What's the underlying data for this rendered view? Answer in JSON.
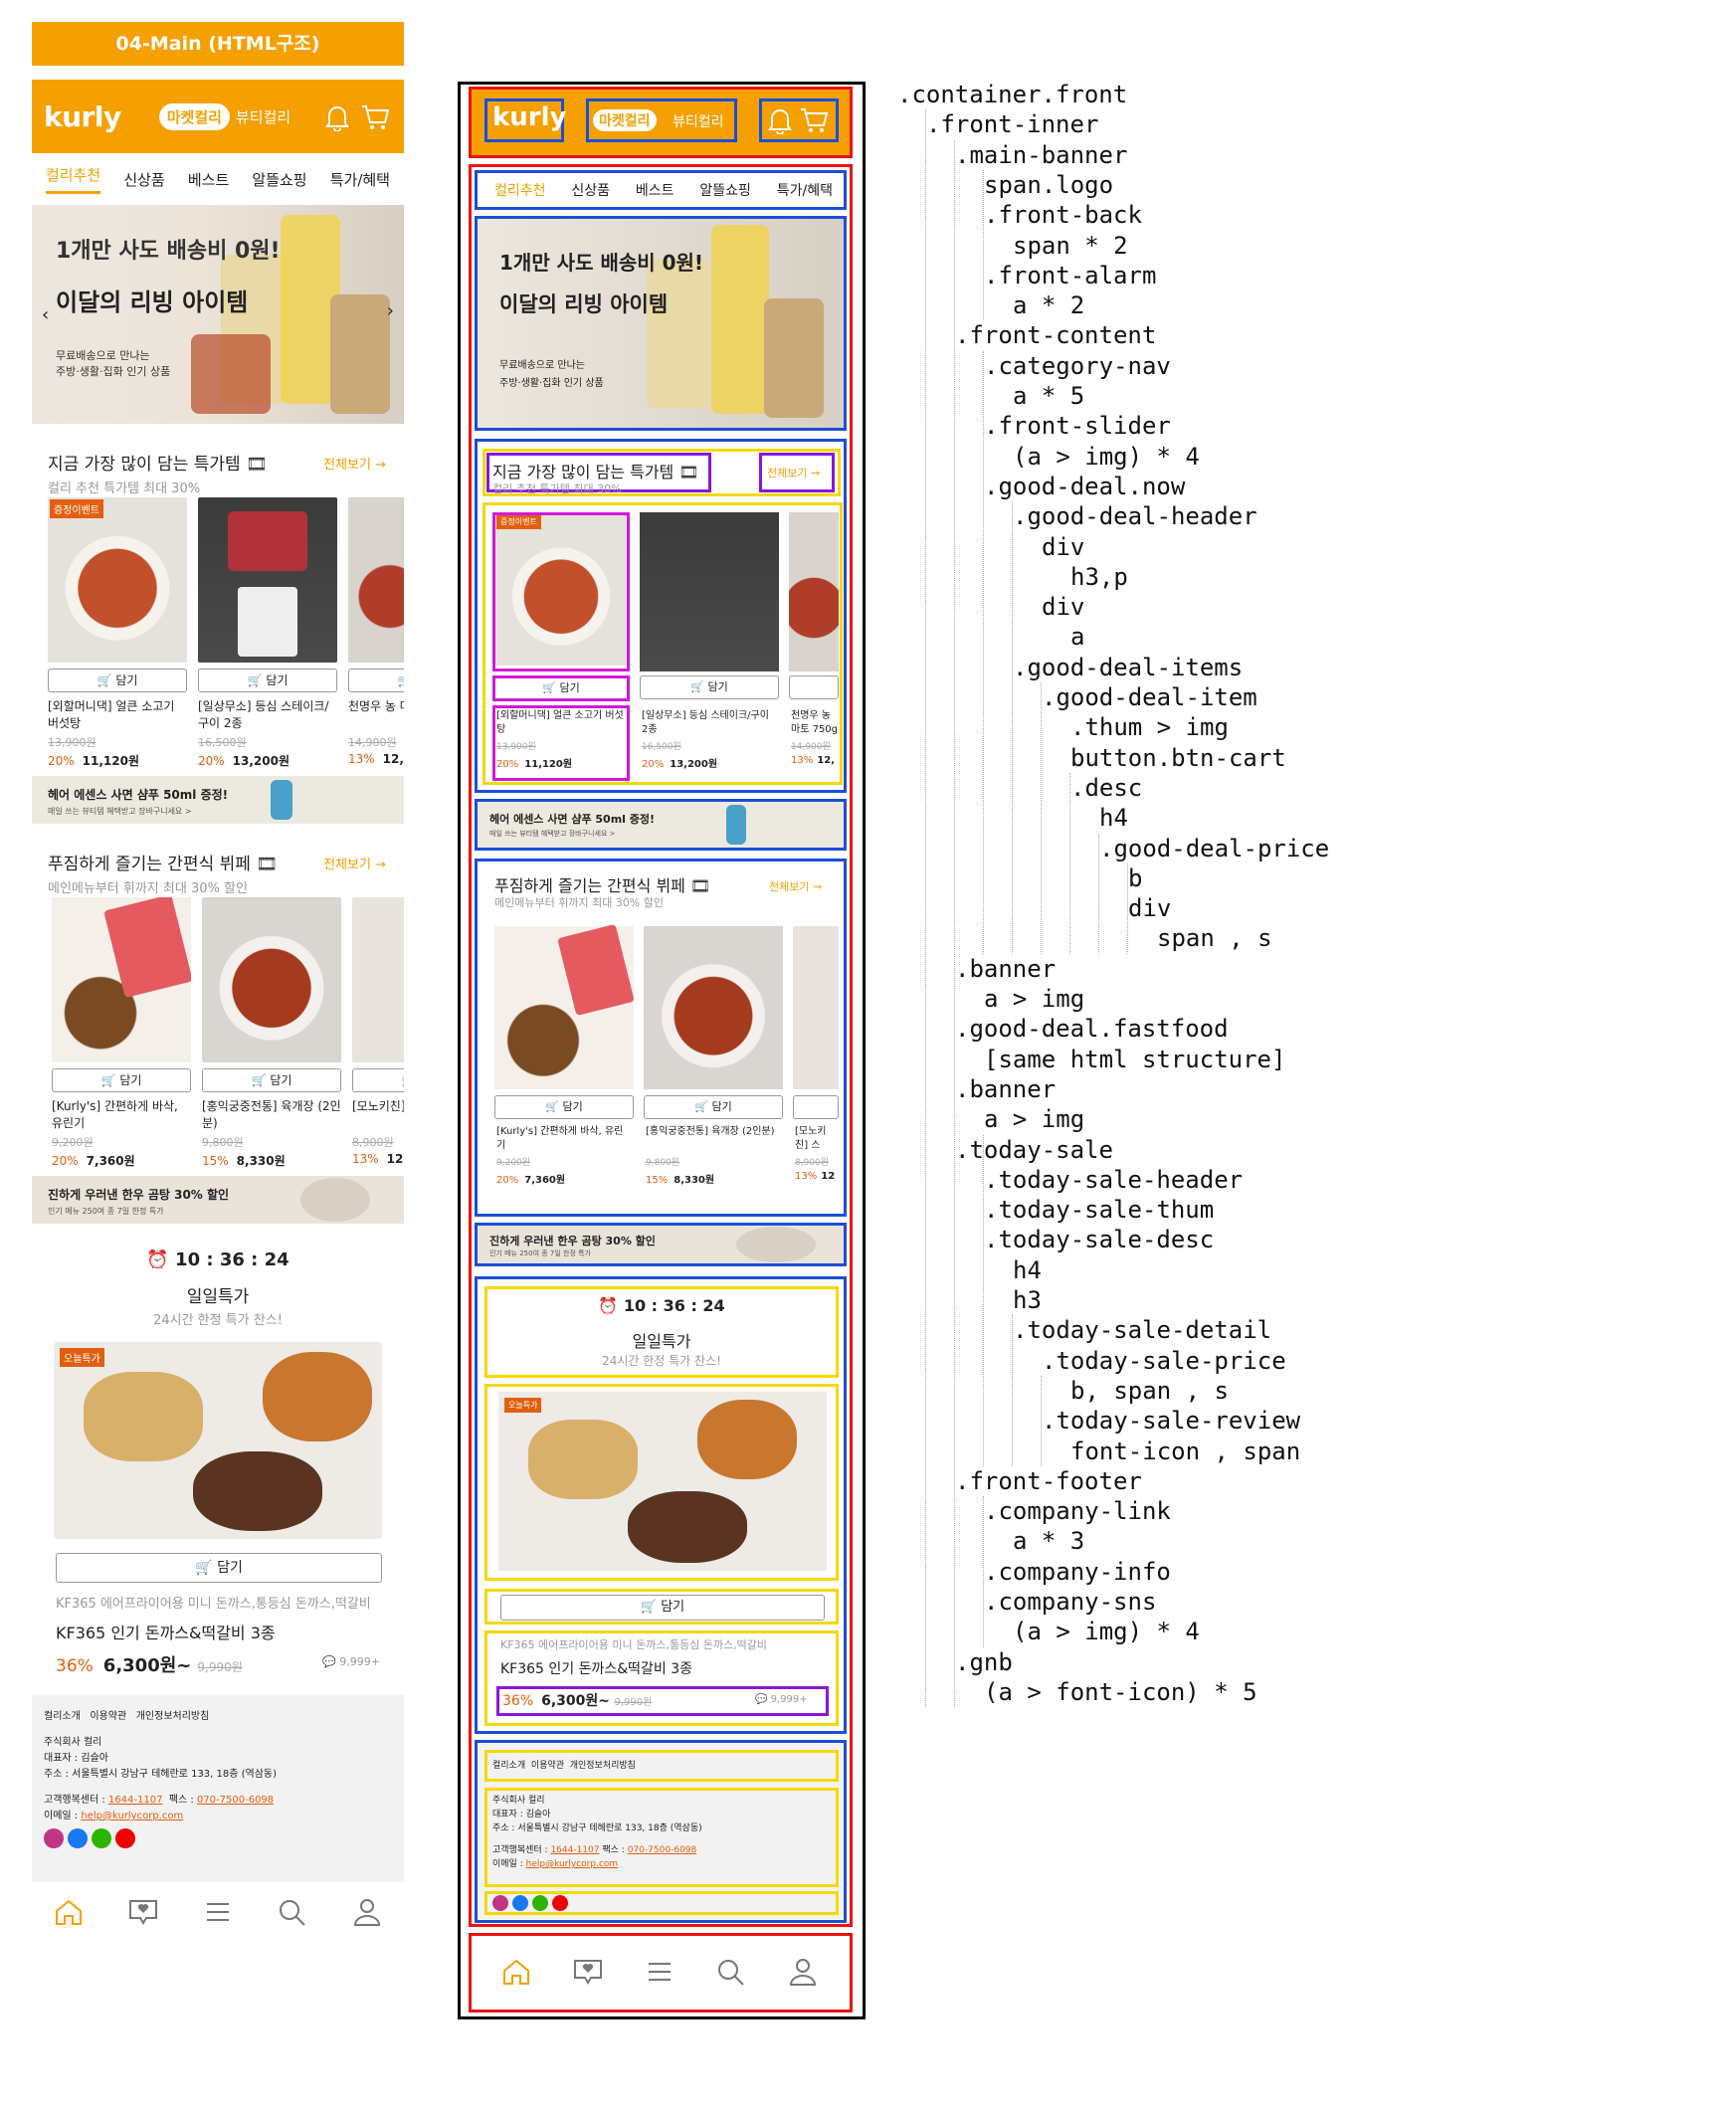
{
  "title": "04-Main (HTML구조)",
  "header": {
    "logo": "kurly",
    "market_tab": "마켓컬리",
    "beauty_tab": "뷰티컬리",
    "icons": [
      "bell-icon",
      "cart-icon"
    ]
  },
  "category_nav": [
    "컬리추천",
    "신상품",
    "베스트",
    "알뜰쇼핑",
    "특가/혜택"
  ],
  "hero": {
    "line1": "1개만 사도 배송비 0원!",
    "line2": "이달의 리빙 아이템",
    "line3": "무료배송으로 만나는",
    "line4": "주방·생활·집화 인기 상품"
  },
  "deal_now": {
    "title": "지금 가장 많이 담는 특가템 🎞",
    "subtitle": "컬리 추천 특가템 최대 30%",
    "more": "전체보기 →",
    "items": [
      {
        "badge": "증정이벤트",
        "cart": "담기",
        "name": "[외할머니댁] 얼큰 소고기 버섯탕",
        "orig": "13,900원",
        "pct": "20%",
        "price": "11,120원"
      },
      {
        "badge": "",
        "cart": "담기",
        "name": "[일상무소] 등심 스테이크/구이 2종",
        "orig": "16,500원",
        "pct": "20%",
        "price": "13,200원"
      },
      {
        "badge": "",
        "cart": "담기",
        "name": "천명우 농 마토 750g",
        "orig": "14,900원",
        "pct": "13%",
        "price": "12,"
      }
    ]
  },
  "banner1": {
    "title": "헤어 에센스 사면 샴푸 50ml 증정!",
    "sub": "매일 쓰는 뷰티템 혜택받고 장바구니세요 >"
  },
  "deal_fast": {
    "title": "푸짐하게 즐기는 간편식 뷔페 🎞",
    "subtitle": "메인메뉴부터 휘까지 최대 30% 할인",
    "more": "전체보기 →",
    "items": [
      {
        "cart": "담기",
        "name": "[Kurly's] 간편하게 바삭, 유린기",
        "orig": "9,200원",
        "pct": "20%",
        "price": "7,360원"
      },
      {
        "cart": "담기",
        "name": "[홍익궁중전통] 육개장 (2인분)",
        "orig": "9,800원",
        "pct": "15%",
        "price": "8,330원"
      },
      {
        "cart": "담기",
        "name": "[모노키친] 스",
        "orig": "8,900원",
        "pct": "13%",
        "price": "12"
      }
    ]
  },
  "banner2": {
    "title": "진하게 우러낸 한우 곰탕 30% 할인",
    "sub": "인기 메뉴 250여 종 7일 한정 특가"
  },
  "today_sale": {
    "timer": "10 : 36 : 24",
    "title": "일일특가",
    "subtitle": "24시간 한정 특가 찬스!",
    "badge": "오늘특가",
    "cart": "담기",
    "sub_name": "KF365 에어프라이어용 미니 돈까스,통등심 돈까스,떡갈비",
    "name": "KF365 인기 돈까스&떡갈비 3종",
    "pct": "36%",
    "price": "6,300원~",
    "orig": "9,990원",
    "reviews": "9,999+"
  },
  "footer": {
    "links": [
      "컬리소개",
      "이용약관",
      "개인정보처리방침"
    ],
    "company": "주식회사 컬리",
    "ceo": "대표자 : 김슬아",
    "address": "주소 : 서울특별시 강남구 테헤란로 133, 18층 (역삼동)",
    "cs_label": "고객행복센터 :",
    "cs_phone": "1644-1107",
    "fax_label": "팩스 :",
    "fax": "070-7500-6098",
    "email_label": "이메일 :",
    "email": "help@kurlycorp.com"
  },
  "gnb": [
    "home-icon",
    "chat-icon",
    "menu-icon",
    "search-icon",
    "user-icon"
  ],
  "colors": {
    "brand": "#f5a000",
    "sale": "#e35f10",
    "red_box": "#ee1111",
    "blue_box": "#1a4fd8",
    "yellow_box": "#f5d80a",
    "magenta_box": "#d01ad8",
    "purple_box": "#8a16d8"
  },
  "tree": [
    ".container.front",
    ".front-inner",
    ".main-banner",
    "span.logo",
    ".front-back",
    "span * 2",
    ".front-alarm",
    "a * 2",
    ".front-content",
    ".category-nav",
    "a * 5",
    ".front-slider",
    "(a > img) * 4",
    ".good-deal.now",
    ".good-deal-header",
    "div",
    "h3,p",
    "div",
    "a",
    ".good-deal-items",
    ".good-deal-item",
    ".thum > img",
    "button.btn-cart",
    ".desc",
    "h4",
    ".good-deal-price",
    "b",
    "div",
    "span , s",
    ".banner",
    "a > img",
    ".good-deal.fastfood",
    "[same html structure]",
    ".banner",
    "a > img",
    ".today-sale",
    ".today-sale-header",
    ".today-sale-thum",
    ".today-sale-desc",
    "h4",
    "h3",
    ".today-sale-detail",
    ".today-sale-price",
    "b, span , s",
    ".today-sale-review",
    "font-icon , span",
    ".front-footer",
    ".company-link",
    "a * 3",
    ".company-info",
    ".company-sns",
    "(a > img) * 4",
    ".gnb",
    "(a > font-icon) * 5"
  ]
}
